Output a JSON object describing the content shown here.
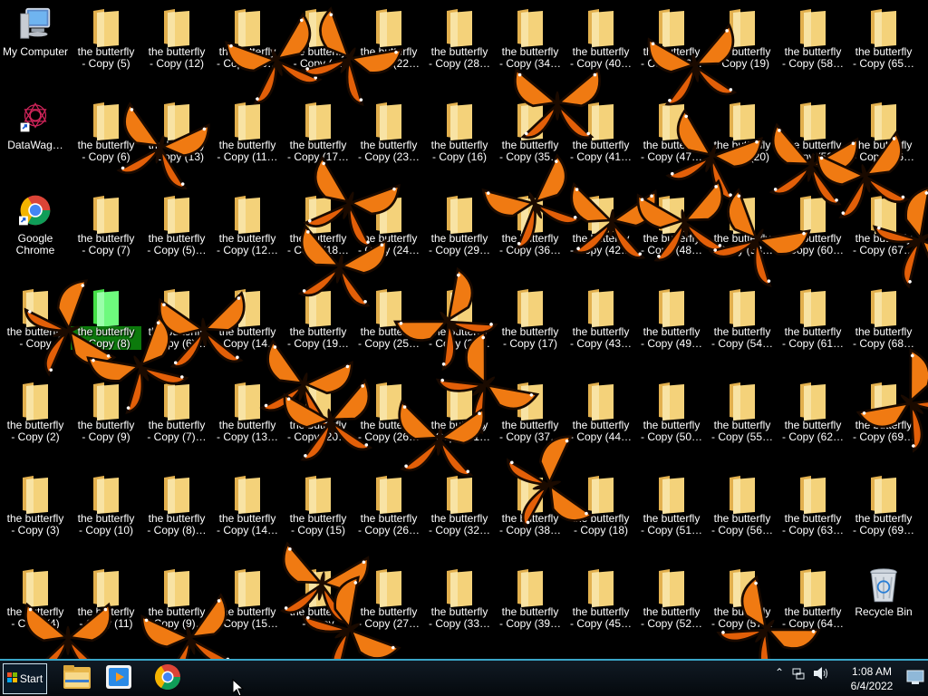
{
  "desktop": {
    "special_icons": [
      {
        "name": "my-computer-icon",
        "label": "My Computer",
        "type": "computer",
        "col": 0,
        "row": 0
      },
      {
        "name": "datawag-icon",
        "label": "DataWag…",
        "type": "datawag",
        "col": 0,
        "row": 1
      },
      {
        "name": "google-chrome-icon",
        "label": "Google\nChrome",
        "type": "chrome",
        "col": 0,
        "row": 2
      },
      {
        "name": "recycle-bin-icon",
        "label": "Recycle Bin",
        "type": "recycle",
        "col": 12,
        "row": 6
      }
    ],
    "folders": [
      {
        "col": 1,
        "row": 0,
        "label": "the butterfly\n- Copy (5)"
      },
      {
        "col": 2,
        "row": 0,
        "label": "the butterfly\n- Copy (12)"
      },
      {
        "col": 3,
        "row": 0,
        "label": "the butterfly\n- Copy (10…"
      },
      {
        "col": 4,
        "row": 0,
        "label": "the butterfly\n- Copy (…"
      },
      {
        "col": 5,
        "row": 0,
        "label": "the butterfly\n- Copy (22…"
      },
      {
        "col": 6,
        "row": 0,
        "label": "the butterfly\n- Copy (28…"
      },
      {
        "col": 7,
        "row": 0,
        "label": "the butterfly\n- Copy (34…"
      },
      {
        "col": 8,
        "row": 0,
        "label": "the butterfly\n- Copy (40…"
      },
      {
        "col": 9,
        "row": 0,
        "label": "the butterfly\n- Copy (46…"
      },
      {
        "col": 10,
        "row": 0,
        "label": "the butterfly\n- Copy (19)"
      },
      {
        "col": 11,
        "row": 0,
        "label": "the butterfly\n- Copy (58…"
      },
      {
        "col": 12,
        "row": 0,
        "label": "the butterfly\n- Copy (65…"
      },
      {
        "col": 1,
        "row": 1,
        "label": "the butterfly\n- Copy (6)"
      },
      {
        "col": 2,
        "row": 1,
        "label": "the butterfly\n- Copy (13)"
      },
      {
        "col": 3,
        "row": 1,
        "label": "the butterfly\n- Copy (11…"
      },
      {
        "col": 4,
        "row": 1,
        "label": "the butterfly\n- Copy (17…"
      },
      {
        "col": 5,
        "row": 1,
        "label": "the butterfly\n- Copy (23…"
      },
      {
        "col": 6,
        "row": 1,
        "label": "the butterfly\n- Copy (16)"
      },
      {
        "col": 7,
        "row": 1,
        "label": "the butterfly\n- Copy (35…"
      },
      {
        "col": 8,
        "row": 1,
        "label": "the butterfly\n- Copy (41…"
      },
      {
        "col": 9,
        "row": 1,
        "label": "the butterfly\n- Copy (47…"
      },
      {
        "col": 10,
        "row": 1,
        "label": "the butterfly\n- Copy (20)"
      },
      {
        "col": 11,
        "row": 1,
        "label": "the butterfly\n- Copy (59…"
      },
      {
        "col": 12,
        "row": 1,
        "label": "the butterfly\n- Copy (66…"
      },
      {
        "col": 1,
        "row": 2,
        "label": "the butterfly\n- Copy (7)"
      },
      {
        "col": 2,
        "row": 2,
        "label": "the butterfly\n- Copy (5)…"
      },
      {
        "col": 3,
        "row": 2,
        "label": "the butterfly\n- Copy (12…"
      },
      {
        "col": 4,
        "row": 2,
        "label": "the butterfly\n- Copy (18…"
      },
      {
        "col": 5,
        "row": 2,
        "label": "the butterfly\n- Copy (24…"
      },
      {
        "col": 6,
        "row": 2,
        "label": "the butterfly\n- Copy (29…"
      },
      {
        "col": 7,
        "row": 2,
        "label": "the butterfly\n- Copy (36…"
      },
      {
        "col": 8,
        "row": 2,
        "label": "the butterfly\n- Copy (42…"
      },
      {
        "col": 9,
        "row": 2,
        "label": "the butterfly\n- Copy (48…"
      },
      {
        "col": 10,
        "row": 2,
        "label": "the butterfly\n- Copy (53…"
      },
      {
        "col": 11,
        "row": 2,
        "label": "the butterfly\n- Copy (60…"
      },
      {
        "col": 12,
        "row": 2,
        "label": "the butterfly\n- Copy (67…"
      },
      {
        "col": 0,
        "row": 3,
        "label": "the butterfly\n- Copy"
      },
      {
        "col": 1,
        "row": 3,
        "label": "the butterfly\n- Copy (8)",
        "selected": true
      },
      {
        "col": 2,
        "row": 3,
        "label": "the butterfly\n- Copy (6)…"
      },
      {
        "col": 3,
        "row": 3,
        "label": "the butterfly\n- Copy (14…"
      },
      {
        "col": 4,
        "row": 3,
        "label": "the butterfly\n- Copy (19…"
      },
      {
        "col": 5,
        "row": 3,
        "label": "the butterfly\n- Copy (25…"
      },
      {
        "col": 6,
        "row": 3,
        "label": "the butterfly\n- Copy (30…"
      },
      {
        "col": 7,
        "row": 3,
        "label": "the butterfly\n- Copy (17)"
      },
      {
        "col": 8,
        "row": 3,
        "label": "the butterfly\n- Copy (43…"
      },
      {
        "col": 9,
        "row": 3,
        "label": "the butterfly\n- Copy (49…"
      },
      {
        "col": 10,
        "row": 3,
        "label": "the butterfly\n- Copy (54…"
      },
      {
        "col": 11,
        "row": 3,
        "label": "the butterfly\n- Copy (61…"
      },
      {
        "col": 12,
        "row": 3,
        "label": "the butterfly\n- Copy (68…"
      },
      {
        "col": 0,
        "row": 4,
        "label": "the butterfly\n- Copy (2)"
      },
      {
        "col": 1,
        "row": 4,
        "label": "the butterfly\n- Copy (9)"
      },
      {
        "col": 2,
        "row": 4,
        "label": "the butterfly\n- Copy (7)…"
      },
      {
        "col": 3,
        "row": 4,
        "label": "the butterfly\n- Copy (13…"
      },
      {
        "col": 4,
        "row": 4,
        "label": "the butterfly\n- Copy (20…"
      },
      {
        "col": 5,
        "row": 4,
        "label": "the butterfly\n- Copy (26…"
      },
      {
        "col": 6,
        "row": 4,
        "label": "the butterfly\n- Copy (31…"
      },
      {
        "col": 7,
        "row": 4,
        "label": "the butterfly\n- Copy (37…"
      },
      {
        "col": 8,
        "row": 4,
        "label": "the butterfly\n- Copy (44…"
      },
      {
        "col": 9,
        "row": 4,
        "label": "the butterfly\n- Copy (50…"
      },
      {
        "col": 10,
        "row": 4,
        "label": "the butterfly\n- Copy (55…"
      },
      {
        "col": 11,
        "row": 4,
        "label": "the butterfly\n- Copy (62…"
      },
      {
        "col": 12,
        "row": 4,
        "label": "the butterfly\n- Copy (69…"
      },
      {
        "col": 0,
        "row": 5,
        "label": "the butterfly\n- Copy (3)"
      },
      {
        "col": 1,
        "row": 5,
        "label": "the butterfly\n- Copy (10)"
      },
      {
        "col": 2,
        "row": 5,
        "label": "the butterfly\n- Copy (8)…"
      },
      {
        "col": 3,
        "row": 5,
        "label": "the butterfly\n- Copy (14…"
      },
      {
        "col": 4,
        "row": 5,
        "label": "the butterfly\n- Copy (15)"
      },
      {
        "col": 5,
        "row": 5,
        "label": "the butterfly\n- Copy (26…"
      },
      {
        "col": 6,
        "row": 5,
        "label": "the butterfly\n- Copy (32…"
      },
      {
        "col": 7,
        "row": 5,
        "label": "the butterfly\n- Copy (38…"
      },
      {
        "col": 8,
        "row": 5,
        "label": "the butterfly\n- Copy (18)"
      },
      {
        "col": 9,
        "row": 5,
        "label": "the butterfly\n- Copy (51…"
      },
      {
        "col": 10,
        "row": 5,
        "label": "the butterfly\n- Copy (56…"
      },
      {
        "col": 11,
        "row": 5,
        "label": "the butterfly\n- Copy (63…"
      },
      {
        "col": 12,
        "row": 5,
        "label": "the butterfly\n- Copy (69…"
      },
      {
        "col": 0,
        "row": 6,
        "label": "the butterfly\n- Copy (4)"
      },
      {
        "col": 1,
        "row": 6,
        "label": "the butterfly\n- Copy (11)"
      },
      {
        "col": 2,
        "row": 6,
        "label": "the butterfly\n- Copy (9)…"
      },
      {
        "col": 3,
        "row": 6,
        "label": "the butterfly\n- Copy (15…"
      },
      {
        "col": 4,
        "row": 6,
        "label": "the butterfly\n- Copy"
      },
      {
        "col": 5,
        "row": 6,
        "label": "the butterfly\n- Copy (27…"
      },
      {
        "col": 6,
        "row": 6,
        "label": "the butterfly\n- Copy (33…"
      },
      {
        "col": 7,
        "row": 6,
        "label": "the butterfly\n- Copy (39…"
      },
      {
        "col": 8,
        "row": 6,
        "label": "the butterfly\n- Copy (45…"
      },
      {
        "col": 9,
        "row": 6,
        "label": "the butterfly\n- Copy (52…"
      },
      {
        "col": 10,
        "row": 6,
        "label": "the butterfly\n- Copy (57…"
      },
      {
        "col": 11,
        "row": 6,
        "label": "the butterfly\n- Copy (64…"
      }
    ]
  },
  "taskbar": {
    "start_label": "Start",
    "pinned": [
      {
        "name": "file-explorer-pin",
        "icon": "folder-icon"
      },
      {
        "name": "media-player-pin",
        "icon": "media-player-icon"
      },
      {
        "name": "chrome-pin",
        "icon": "chrome-icon"
      }
    ],
    "clock": {
      "time": "1:08 AM",
      "date": "6/4/2022"
    }
  },
  "colors": {
    "folder": "#f4d27a",
    "folder_dark": "#e2b04e",
    "selection": "#0c7a0c",
    "butterfly_wing": "#f07a12",
    "taskbar_accent": "#3aa6c8"
  }
}
